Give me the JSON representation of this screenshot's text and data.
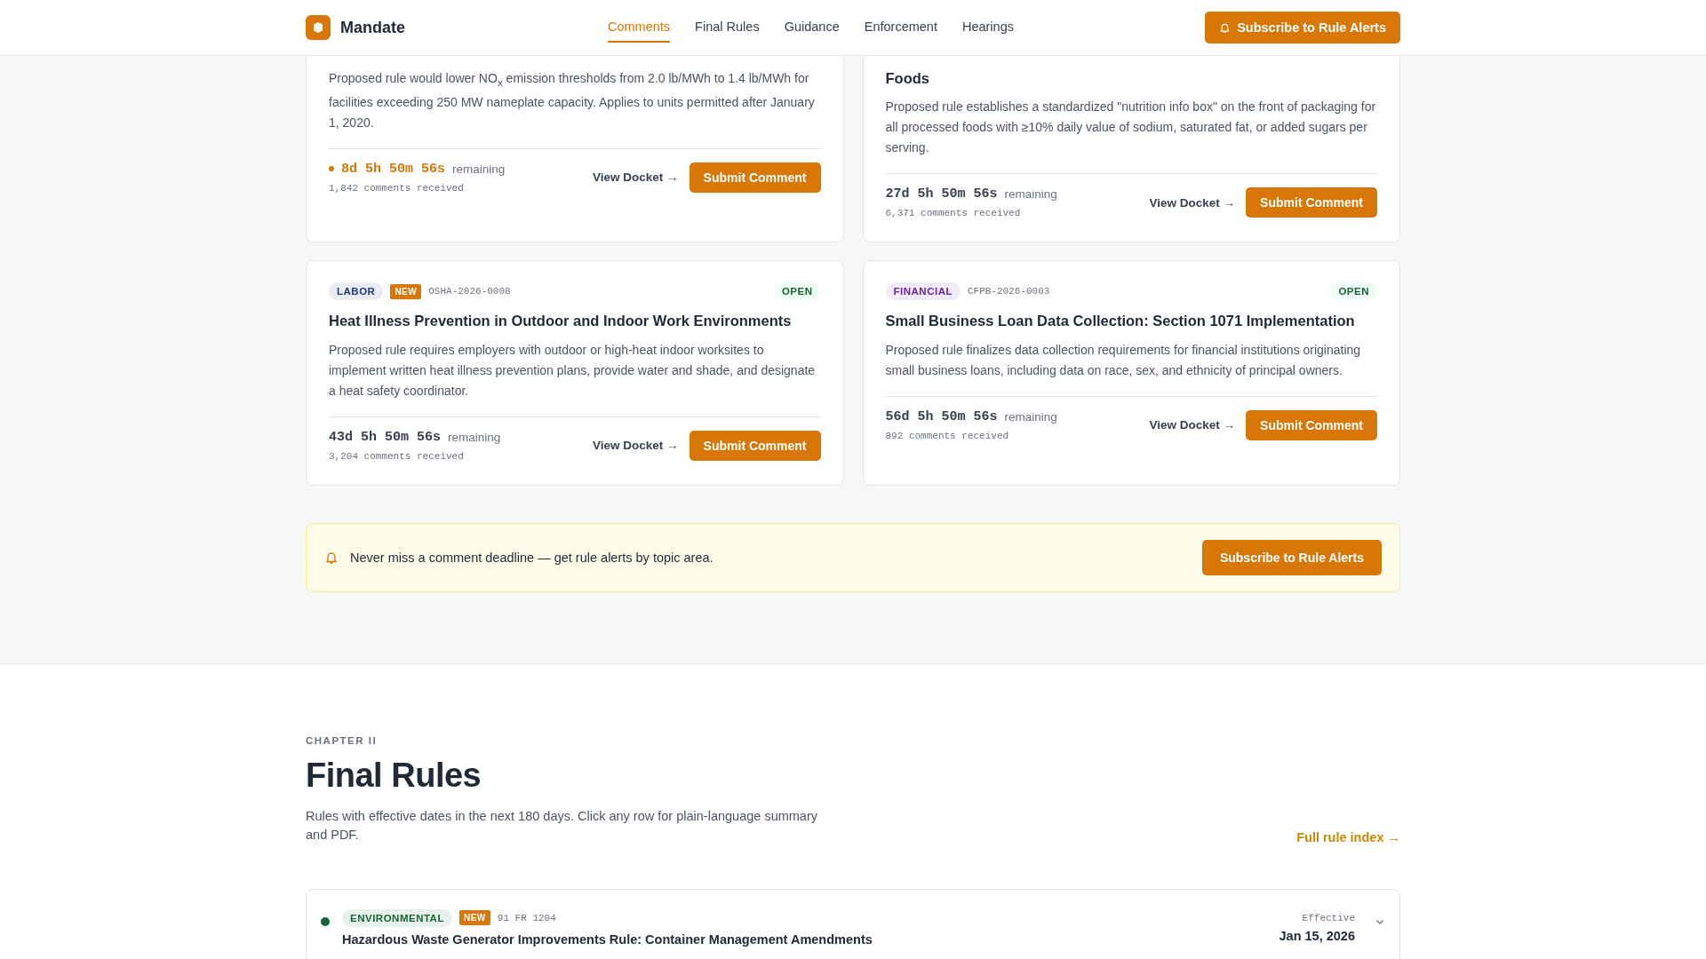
{
  "header": {
    "brand": "Mandate",
    "nav": [
      {
        "label": "Comments",
        "selected": true
      },
      {
        "label": "Final Rules",
        "selected": false
      },
      {
        "label": "Guidance",
        "selected": false
      },
      {
        "label": "Enforcement",
        "selected": false
      },
      {
        "label": "Hearings",
        "selected": false
      }
    ],
    "subscribe": "Subscribe to Rule Alerts"
  },
  "top_cards": [
    {
      "description": "Proposed rule would lower NO$_{x}$ emission thresholds from 2.0 lb/MWh to 1.4 lb/MWh for facilities exceeding 250 MW nameplate capacity. Applies to units permitted after January 1, 2020.",
      "countdown": "8d 5h 50m 56s",
      "urgent": true,
      "remaining": "remaining",
      "comments": "1,842 comments received",
      "docket": "View Docket →",
      "submit": "Submit Comment"
    },
    {
      "title": "Foods",
      "description": "Proposed rule establishes a standardized \"nutrition info box\" on the front of packaging for all processed foods with ≥10% daily value of sodium, saturated fat, or added sugars per serving.",
      "countdown": "27d 5h 50m 56s",
      "urgent": false,
      "remaining": "remaining",
      "comments": "6,371 comments received",
      "docket": "View Docket →",
      "submit": "Submit Comment"
    }
  ],
  "cards": [
    {
      "tag": "LABOR",
      "color": "#1e3a8a",
      "badge": "NEW",
      "docket_id": "OSHA-2026-0008",
      "status": "OPEN",
      "title": "Heat Illness Prevention in Outdoor and Indoor Work Environments",
      "description": "Proposed rule requires employers with outdoor or high-heat indoor worksites to implement written heat illness prevention plans, provide water and shade, and designate a heat safety coordinator.",
      "countdown": "43d 5h 50m 56s",
      "urgent": false,
      "remaining": "remaining",
      "comments": "3,204 comments received",
      "docket": "View Docket →",
      "submit": "Submit Comment"
    },
    {
      "tag": "FINANCIAL",
      "color": "#6b21a8",
      "docket_id": "CFPB-2026-0003",
      "status": "OPEN",
      "title": "Small Business Loan Data Collection: Section 1071 Implementation",
      "description": "Proposed rule finalizes data collection requirements for financial institutions originating small business loans, including data on race, sex, and ethnicity of principal owners.",
      "countdown": "56d 5h 50m 56s",
      "urgent": false,
      "remaining": "remaining",
      "comments": "892 comments received",
      "docket": "View Docket →",
      "submit": "Submit Comment"
    }
  ],
  "banner": {
    "text": "Never miss a comment deadline — get rule alerts by topic area.",
    "button": "Subscribe to Rule Alerts"
  },
  "final_rules": {
    "eyebrow": "CHAPTER II",
    "heading": "Final Rules",
    "intro": "Rules with effective dates in the next 180 days. Click any row for plain-language summary and PDF.",
    "index_link": "Full rule index →",
    "rows": [
      {
        "color": "#166534",
        "tag": "ENVIRONMENTAL",
        "badge": "NEW",
        "citation": "91 FR 1204",
        "title": "Hazardous Waste Generator Improvements Rule: Container Management Amendments",
        "effective_label": "Effective",
        "effective_date": "Jan 15, 2026",
        "expanded": false
      }
    ]
  }
}
